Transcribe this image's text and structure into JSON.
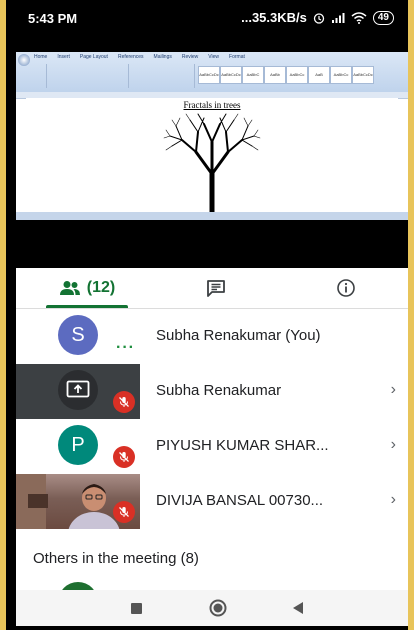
{
  "status_bar": {
    "time": "5:43 PM",
    "network_speed": "...35.3KB/s",
    "battery": "49"
  },
  "shared_screen": {
    "doc_title": "Fractals in trees",
    "ribbon_tabs": [
      "Home",
      "Insert",
      "Page Layout",
      "References",
      "Mailings",
      "Review",
      "View",
      "Format"
    ],
    "styles": [
      "AaBbCcDc",
      "AaBbCcDc",
      "AaBbC",
      "AaBb",
      "AaBbCc",
      "AaB",
      "AaBbCc",
      "AaBbCcDc"
    ]
  },
  "tabs": {
    "people_count": "(12)"
  },
  "participants": [
    {
      "initial": "S",
      "name": "Subha Renakumar (You)",
      "avatar_color": "#5c6bc0"
    },
    {
      "name": "Subha Renakumar",
      "presenting": true
    },
    {
      "initial": "P",
      "name": "PIYUSH KUMAR SHAR...",
      "avatar_color": "#00897b"
    },
    {
      "name": "DIVIJA BANSAL 00730..."
    }
  ],
  "others_heading": "Others in the meeting (8)",
  "colors": {
    "accent_green": "#137333",
    "mic_off_red": "#d93025"
  },
  "icons": [
    "people-icon",
    "chat-icon",
    "info-icon",
    "present-icon",
    "mic-off-icon",
    "chevron-right-icon",
    "recents-icon",
    "home-icon",
    "back-icon"
  ]
}
